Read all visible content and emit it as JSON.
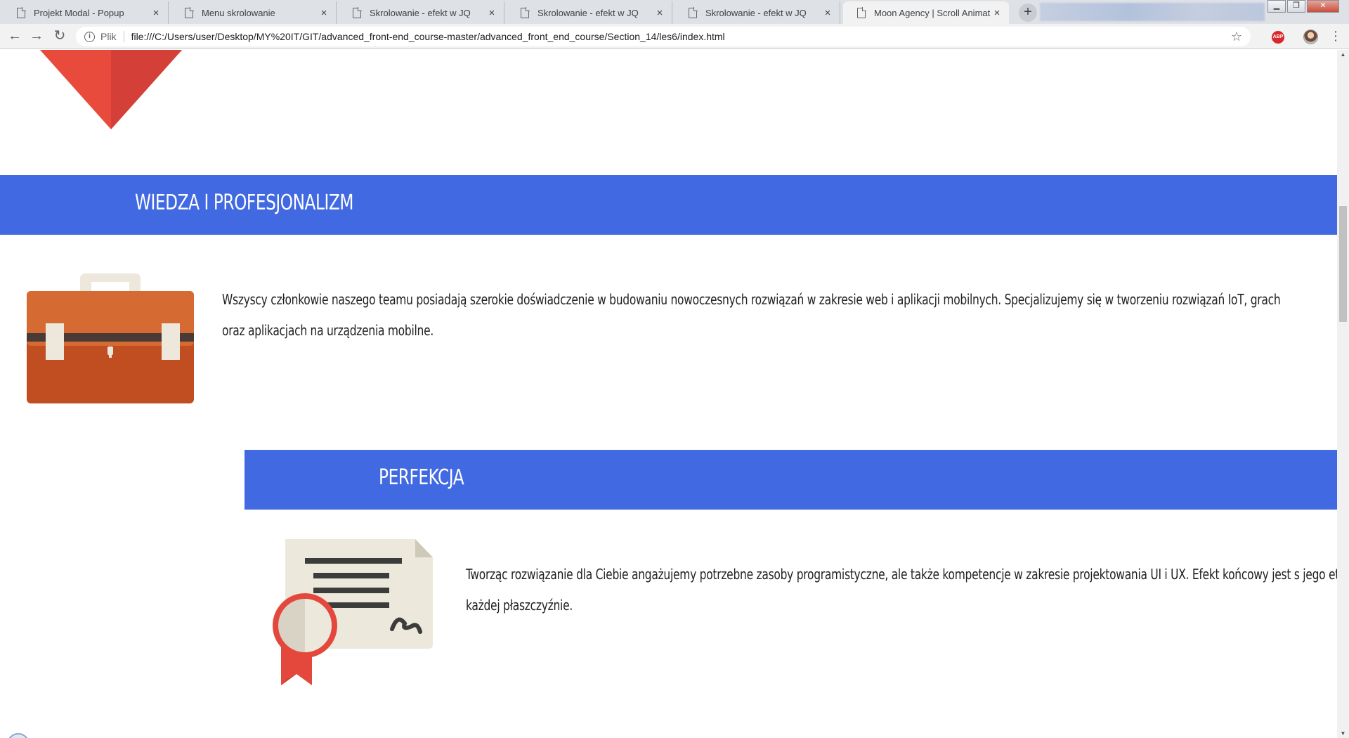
{
  "browser": {
    "tabs": [
      {
        "title": "Projekt Modal - Popup",
        "active": false
      },
      {
        "title": "Menu skrolowanie",
        "active": false
      },
      {
        "title": "Skrolowanie - efekt w JQ",
        "active": false
      },
      {
        "title": "Skrolowanie - efekt w JQ",
        "active": false
      },
      {
        "title": "Skrolowanie - efekt w JQ",
        "active": false
      },
      {
        "title": "Moon Agency | Scroll Animation",
        "active": true
      }
    ],
    "tab_close_glyph": "×",
    "new_tab_glyph": "+",
    "site_label": "Plik",
    "url": "file:///C:/Users/user/Desktop/MY%20IT/GIT/advanced_front-end_course-master/advanced_front_end_course/Section_14/les6/index.html",
    "abp_label": "ABP"
  },
  "page": {
    "sections": [
      {
        "title": "WIEDZA I PROFESJONALIZM",
        "text": "Wszyscy członkowie naszego teamu posiadają szerokie doświadczenie w budowaniu nowoczesnych rozwiązań w zakresie web i aplikacji mobilnych. Specjalizujemy się w tworzeniu rozwiązań IoT, grach oraz aplikacjach na urządzenia mobilne.",
        "icon": "briefcase-icon"
      },
      {
        "title": "PERFEKCJA",
        "text": "Tworząc rozwiązanie dla Ciebie angażujemy potrzebne zasoby programistyczne, ale także kompetencje w zakresie projektowania UI i UX. Efekt końcowy jest s jego etpaie i każdej płaszczyźnie.",
        "icon": "certificate-icon"
      }
    ]
  },
  "colors": {
    "band": "#4169e1",
    "heart": "#e84a3c",
    "briefcase": "#d2602c",
    "certificate": "#ece8dc",
    "ribbon": "#e4483c"
  }
}
